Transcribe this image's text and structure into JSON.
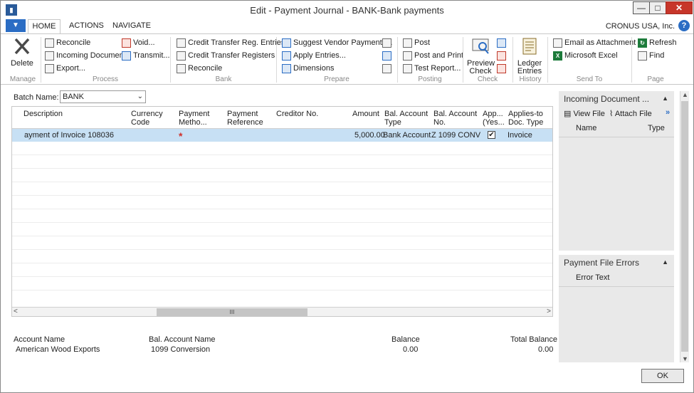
{
  "window": {
    "title": "Edit - Payment Journal - BANK-Bank payments",
    "min": "—",
    "max": "□",
    "close": "✕",
    "app_glyph": "📊"
  },
  "tabs": {
    "app_menu": "▼",
    "home": "HOME",
    "actions": "ACTIONS",
    "navigate": "NAVIGATE"
  },
  "company": "CRONUS USA, Inc.",
  "ribbon": {
    "manage": {
      "label": "Manage",
      "delete": "Delete"
    },
    "process": {
      "label": "Process",
      "reconcile": "Reconcile",
      "incoming_document": "Incoming Document",
      "export": "Export...",
      "void": "Void...",
      "transmit": "Transmit..."
    },
    "bank": {
      "label": "Bank",
      "credit_transfer_reg_entries": "Credit Transfer Reg. Entries",
      "credit_transfer_registers": "Credit Transfer Registers",
      "reconcile": "Reconcile"
    },
    "prepare": {
      "label": "Prepare",
      "suggest_vendor_payments": "Suggest Vendor Payments...",
      "apply_entries": "Apply Entries...",
      "dimensions": "Dimensions"
    },
    "posting": {
      "label": "Posting",
      "post": "Post",
      "post_and_print": "Post and Print",
      "test_report": "Test Report..."
    },
    "check": {
      "label": "Check",
      "preview_check_1": "Preview",
      "preview_check_2": "Check"
    },
    "history": {
      "label": "History",
      "ledger_entries_1": "Ledger",
      "ledger_entries_2": "Entries"
    },
    "send_to": {
      "label": "Send To",
      "email_attachment": "Email as Attachment",
      "microsoft_excel": "Microsoft Excel"
    },
    "page": {
      "label": "Page",
      "refresh": "Refresh",
      "find": "Find"
    }
  },
  "batch": {
    "label": "Batch Name:",
    "value": "BANK"
  },
  "grid": {
    "columns": {
      "description": "Description",
      "currency_code_1": "Currency",
      "currency_code_2": "Code",
      "payment_method_1": "Payment",
      "payment_method_2": "Metho...",
      "payment_reference_1": "Payment",
      "payment_reference_2": "Reference",
      "creditor_no": "Creditor No.",
      "amount": "Amount",
      "bal_account_type_1": "Bal. Account",
      "bal_account_type_2": "Type",
      "bal_account_no_1": "Bal. Account",
      "bal_account_no_2": "No.",
      "applies_yes_1": "App...",
      "applies_yes_2": "(Yes...",
      "applies_to_doc_type_1": "Applies-to",
      "applies_to_doc_type_2": "Doc. Type"
    },
    "rows": [
      {
        "description": "ayment of Invoice 108036",
        "payment_method_required": "*",
        "amount": "5,000.00",
        "bal_account_type": "Bank Account",
        "bal_account_no": "Z 1099 CONV",
        "applies_checked": "✔",
        "applies_to_doc_type": "Invoice"
      }
    ],
    "hscroll": {
      "left": "<",
      "right": ">",
      "grip": "III"
    }
  },
  "footer": {
    "account_name_label": "Account Name",
    "account_name_value": "American Wood Exports",
    "bal_account_name_label": "Bal. Account Name",
    "bal_account_name_value": "1099 Conversion",
    "balance_label": "Balance",
    "balance_value": "0.00",
    "total_balance_label": "Total Balance",
    "total_balance_value": "0.00"
  },
  "factbox": {
    "incoming": {
      "title": "Incoming Document ...",
      "caret": "▲",
      "view_file": "View File",
      "attach_file": "Attach File",
      "more": "»",
      "col_name": "Name",
      "col_type": "Type"
    },
    "errors": {
      "title": "Payment File Errors",
      "caret": "▲",
      "col_error_text": "Error Text"
    }
  },
  "vscroll": {
    "up": "▲",
    "down": "▼"
  },
  "ok_label": "OK"
}
